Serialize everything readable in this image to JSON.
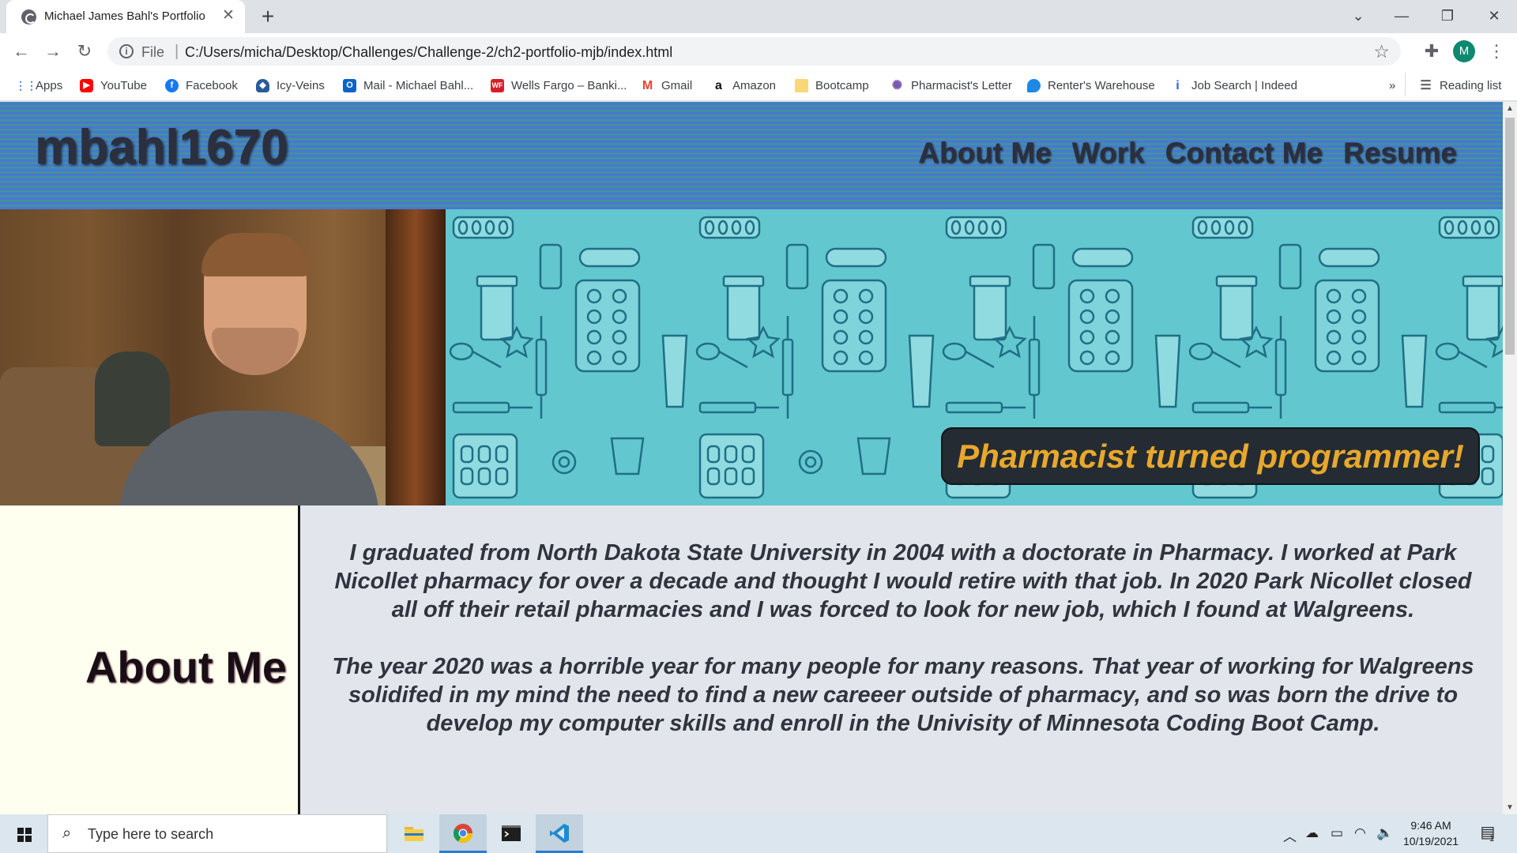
{
  "browser": {
    "tab_title": "Michael James Bahl's Portfolio",
    "url_scheme": "File",
    "url": "C:/Users/micha/Desktop/Challenges/Challenge-2/ch2-portfolio-mjb/index.html",
    "profile_initial": "M"
  },
  "bookmarks": [
    {
      "label": "Apps",
      "icon": "apps-grid-icon",
      "color": "#4285f4"
    },
    {
      "label": "YouTube",
      "icon": "youtube-icon",
      "color": "#ff0000"
    },
    {
      "label": "Facebook",
      "icon": "facebook-icon",
      "color": "#1877f2"
    },
    {
      "label": "Icy-Veins",
      "icon": "icy-veins-icon",
      "color": "#2a5a9a"
    },
    {
      "label": "Mail - Michael Bahl...",
      "icon": "outlook-icon",
      "color": "#0a64c8"
    },
    {
      "label": "Wells Fargo – Banki...",
      "icon": "wells-fargo-icon",
      "color": "#d71e28"
    },
    {
      "label": "Gmail",
      "icon": "gmail-icon",
      "color": "#ea4335"
    },
    {
      "label": "Amazon",
      "icon": "amazon-icon",
      "color": "#111111"
    },
    {
      "label": "Bootcamp",
      "icon": "folder-icon",
      "color": "#f8d774"
    },
    {
      "label": "Pharmacist's Letter",
      "icon": "pharmacists-letter-icon",
      "color": "#7a5ab0"
    },
    {
      "label": "Renter's Warehouse",
      "icon": "renters-warehouse-icon",
      "color": "#1e88e5"
    },
    {
      "label": "Job Search | Indeed",
      "icon": "indeed-icon",
      "color": "#2164f3"
    }
  ],
  "bookmarks_overflow": "»",
  "reading_list": "Reading list",
  "site": {
    "brand": "mbahl1670",
    "nav": [
      "About Me",
      "Work",
      "Contact Me",
      "Resume"
    ],
    "tagline": "Pharmacist turned programmer!",
    "about_title": "About Me",
    "about_paragraphs": [
      "I graduated from North Dakota State University in 2004 with a doctorate in Pharmacy. I worked at Park Nicollet pharmacy for over a decade and thought I would retire with that job. In 2020 Park Nicollet closed all off their retail pharmacies and I was forced to look for new job, which I found at Walgreens.",
      "The year 2020 was a horrible year for many people for many reasons. That year of working for Walgreens solidifed in my mind the need to find a new careeer outside of pharmacy, and so was born the drive to develop my computer skills and enroll in the Univisity of Minnesota Coding Boot Camp."
    ]
  },
  "taskbar": {
    "search_placeholder": "Type here to search",
    "time": "9:46 AM",
    "date": "10/19/2021",
    "notification_count": "1"
  }
}
